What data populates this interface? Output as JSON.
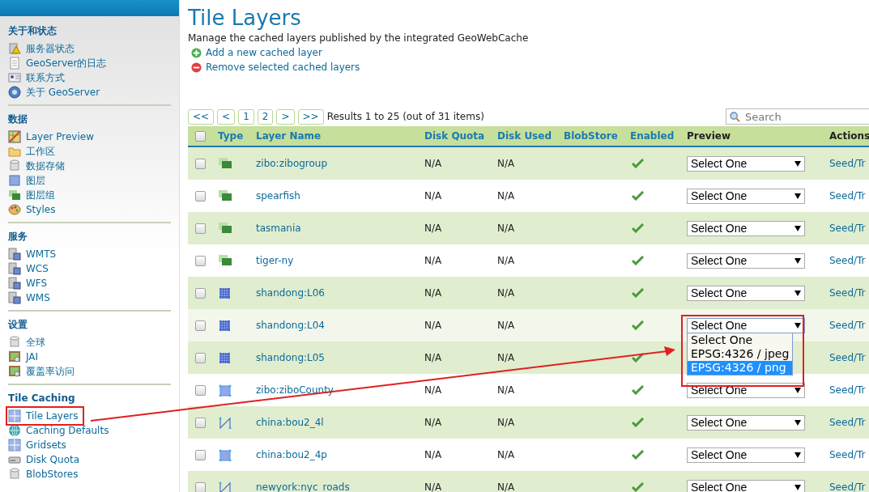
{
  "sidebar": {
    "sections": [
      {
        "title": "关于和状态",
        "items": [
          {
            "label": "服务器状态",
            "kind": "warning",
            "selected": false
          },
          {
            "label": "GeoServer的日志",
            "kind": "document",
            "selected": false
          },
          {
            "label": "联系方式",
            "kind": "card",
            "selected": false
          },
          {
            "label": "关于 GeoServer",
            "kind": "help",
            "selected": false
          }
        ]
      },
      {
        "title": "数据",
        "items": [
          {
            "label": "Layer Preview",
            "kind": "preview",
            "selected": false
          },
          {
            "label": "工作区",
            "kind": "folder",
            "selected": false
          },
          {
            "label": "数据存储",
            "kind": "cylinder",
            "selected": false
          },
          {
            "label": "图层",
            "kind": "square",
            "selected": false
          },
          {
            "label": "图层组",
            "kind": "group",
            "selected": false
          },
          {
            "label": "Styles",
            "kind": "palette",
            "selected": false
          }
        ]
      },
      {
        "title": "服务",
        "items": [
          {
            "label": "WMTS",
            "kind": "server",
            "selected": false
          },
          {
            "label": "WCS",
            "kind": "server",
            "selected": false
          },
          {
            "label": "WFS",
            "kind": "server",
            "selected": false
          },
          {
            "label": "WMS",
            "kind": "server",
            "selected": false
          }
        ]
      },
      {
        "title": "设置",
        "items": [
          {
            "label": "全球",
            "kind": "cylinder",
            "selected": false
          },
          {
            "label": "JAI",
            "kind": "image",
            "selected": false
          },
          {
            "label": "覆盖率访问",
            "kind": "image",
            "selected": false
          }
        ]
      },
      {
        "title": "Tile Caching",
        "items": [
          {
            "label": "Tile Layers",
            "kind": "grid",
            "selected": true
          },
          {
            "label": "Caching Defaults",
            "kind": "globe",
            "selected": false
          },
          {
            "label": "Gridsets",
            "kind": "grid",
            "selected": false
          },
          {
            "label": "Disk Quota",
            "kind": "drive",
            "selected": false
          },
          {
            "label": "BlobStores",
            "kind": "cylinder",
            "selected": false
          }
        ]
      }
    ]
  },
  "page": {
    "title": "Tile Layers",
    "description": "Manage the cached layers published by the integrated GeoWebCache",
    "actions": [
      {
        "label": "Add a new cached layer",
        "kind": "add"
      },
      {
        "label": "Remove selected cached layers",
        "kind": "remove"
      }
    ]
  },
  "pager": {
    "buttons": [
      {
        "label": "<<",
        "selected": false
      },
      {
        "label": "<",
        "selected": false
      },
      {
        "label": "1",
        "selected": false
      },
      {
        "label": "2",
        "selected": false
      },
      {
        "label": ">",
        "selected": false
      },
      {
        "label": ">>",
        "selected": false
      }
    ],
    "summary": "Results 1 to 25 (out of 31 items)"
  },
  "search": {
    "placeholder": "Search"
  },
  "table": {
    "select_all": {
      "checked": false
    },
    "columns": [
      "Type",
      "Layer Name",
      "Disk Quota",
      "Disk Used",
      "BlobStore",
      "Enabled",
      "Preview",
      "Actions"
    ],
    "rows": [
      {
        "kind": "group",
        "name": "zibo:zibogroup",
        "disk_quota": "N/A",
        "disk_used": "N/A",
        "enabled": true,
        "preview": "Select One",
        "action": "Seed/Tr",
        "checked": false,
        "highlighted": false
      },
      {
        "kind": "group",
        "name": "spearfish",
        "disk_quota": "N/A",
        "disk_used": "N/A",
        "enabled": true,
        "preview": "Select One",
        "action": "Seed/Tr",
        "checked": false,
        "highlighted": false
      },
      {
        "kind": "group",
        "name": "tasmania",
        "disk_quota": "N/A",
        "disk_used": "N/A",
        "enabled": true,
        "preview": "Select One",
        "action": "Seed/Tr",
        "checked": false,
        "highlighted": false
      },
      {
        "kind": "group",
        "name": "tiger-ny",
        "disk_quota": "N/A",
        "disk_used": "N/A",
        "enabled": true,
        "preview": "Select One",
        "action": "Seed/Tr",
        "checked": false,
        "highlighted": false
      },
      {
        "kind": "raster",
        "name": "shandong:L06",
        "disk_quota": "N/A",
        "disk_used": "N/A",
        "enabled": true,
        "preview": "Select One",
        "action": "Seed/Tr",
        "checked": false,
        "highlighted": false
      },
      {
        "kind": "raster",
        "name": "shandong:L04",
        "disk_quota": "N/A",
        "disk_used": "N/A",
        "enabled": true,
        "preview": "Select One",
        "action": "Seed/Tr",
        "checked": false,
        "highlighted": true,
        "options": [
          {
            "label": "Select One",
            "selected": false
          },
          {
            "label": "EPSG:4326 / jpeg",
            "selected": false
          },
          {
            "label": "EPSG:4326 / png",
            "selected": true
          }
        ]
      },
      {
        "kind": "raster",
        "name": "shandong:L05",
        "disk_quota": "N/A",
        "disk_used": "N/A",
        "enabled": true,
        "action": "Seed/Tr",
        "checked": false,
        "highlighted": false
      },
      {
        "kind": "polygon",
        "name": "zibo:ziboCounty",
        "disk_quota": "N/A",
        "disk_used": "N/A",
        "enabled": true,
        "preview": "Select One",
        "action": "Seed/Tr",
        "checked": false,
        "highlighted": false
      },
      {
        "kind": "line",
        "name": "china:bou2_4l",
        "disk_quota": "N/A",
        "disk_used": "N/A",
        "enabled": true,
        "preview": "Select One",
        "action": "Seed/Tr",
        "checked": false,
        "highlighted": false
      },
      {
        "kind": "polygon",
        "name": "china:bou2_4p",
        "disk_quota": "N/A",
        "disk_used": "N/A",
        "enabled": true,
        "preview": "Select One",
        "action": "Seed/Tr",
        "checked": false,
        "highlighted": false
      },
      {
        "kind": "line",
        "name": "newyork:nyc_roads",
        "disk_quota": "N/A",
        "disk_used": "N/A",
        "enabled": true,
        "preview": "Select One",
        "action": "Seed/Tr",
        "checked": false,
        "highlighted": false
      }
    ]
  }
}
